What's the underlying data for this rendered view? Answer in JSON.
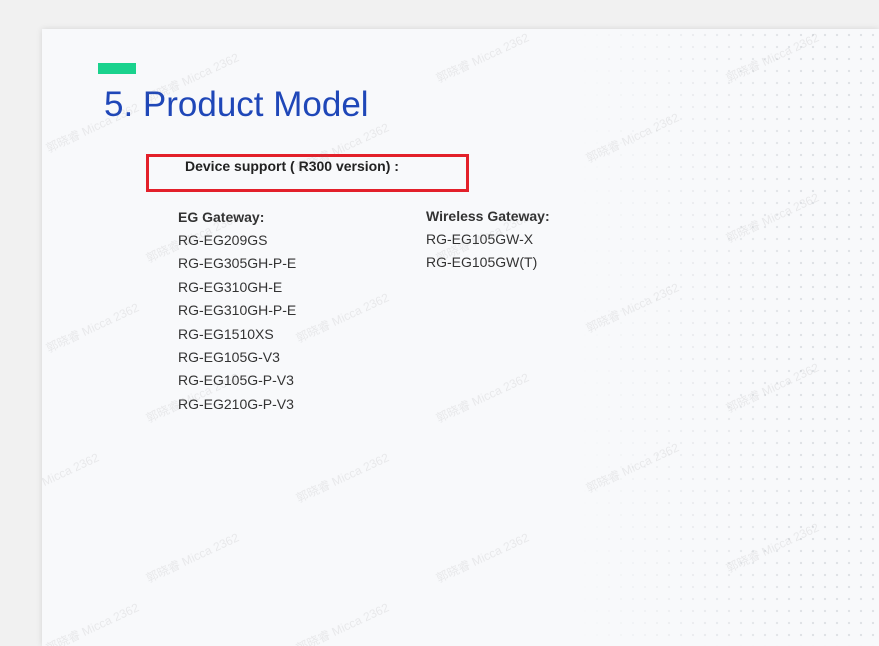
{
  "slide": {
    "title": "5. Product Model",
    "heading": "Device support ( R300 version) :",
    "accent_color": "#1ad28d",
    "title_color": "#1f47b8",
    "highlight_color": "#e3202a"
  },
  "eg_gateway": {
    "label": "EG Gateway:",
    "models": [
      "RG-EG209GS",
      "RG-EG305GH-P-E",
      "RG-EG310GH-E",
      "RG-EG310GH-P-E",
      "RG-EG1510XS",
      "RG-EG105G-V3",
      "RG-EG105G-P-V3",
      "RG-EG210G-P-V3"
    ]
  },
  "wireless_gateway": {
    "label": "Wireless Gateway:",
    "models": [
      "RG-EG105GW-X",
      "RG-EG105GW(T)"
    ]
  },
  "watermark": {
    "text": "郭晓睿 Micca 2362"
  }
}
